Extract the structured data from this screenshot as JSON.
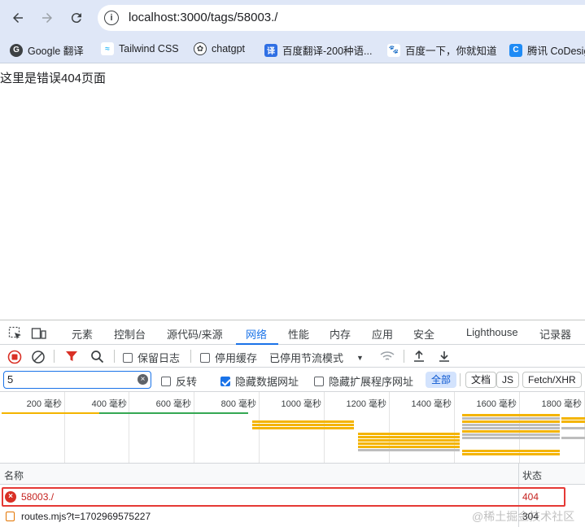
{
  "browser": {
    "url": "localhost:3000/tags/58003./",
    "bookmarks": [
      {
        "label": "Google 翻译",
        "icon": "google-translate-icon"
      },
      {
        "label": "Tailwind CSS",
        "icon": "tailwind-icon"
      },
      {
        "label": "chatgpt",
        "icon": "chatgpt-icon"
      },
      {
        "label": "百度翻译-200种语...",
        "icon": "baidu-translate-icon"
      },
      {
        "label": "百度一下，你就知道",
        "icon": "baidu-icon"
      },
      {
        "label": "腾讯 CoDesign",
        "icon": "codesign-icon"
      }
    ]
  },
  "page": {
    "text": "这里是错误404页面"
  },
  "devtools": {
    "tabs": [
      "元素",
      "控制台",
      "源代码/来源",
      "网络",
      "性能",
      "内存",
      "应用",
      "安全",
      "Lighthouse",
      "记录器"
    ],
    "active_tab": "网络",
    "toolbar": {
      "preserve_log": "保留日志",
      "disable_cache": "停用缓存",
      "throttling": "已停用节流模式"
    },
    "filter": {
      "value": "5",
      "invert": "反转",
      "hide_data_urls": "隐藏数据网址",
      "hide_extension_urls": "隐藏扩展程序网址",
      "types": [
        "全部",
        "文档",
        "JS",
        "Fetch/XHR"
      ],
      "active_type": "全部"
    },
    "timeline": {
      "ticks": [
        "200 毫秒",
        "400 毫秒",
        "600 毫秒",
        "800 毫秒",
        "1000 毫秒",
        "1200 毫秒",
        "1400 毫秒",
        "1600 毫秒",
        "1800 毫秒"
      ]
    },
    "table": {
      "headers": {
        "name": "名称",
        "status": "状态"
      },
      "rows": [
        {
          "name": "58003./",
          "status": "404",
          "error": true
        },
        {
          "name": "routes.mjs?t=1702969575227",
          "status": "304",
          "error": false
        }
      ]
    }
  },
  "watermark": "@稀土掘金技术社区",
  "colors": {
    "chrome_bg": "#dfe7f7",
    "accent": "#1a73e8",
    "error": "#d93025",
    "highlight_border": "#e53935"
  }
}
